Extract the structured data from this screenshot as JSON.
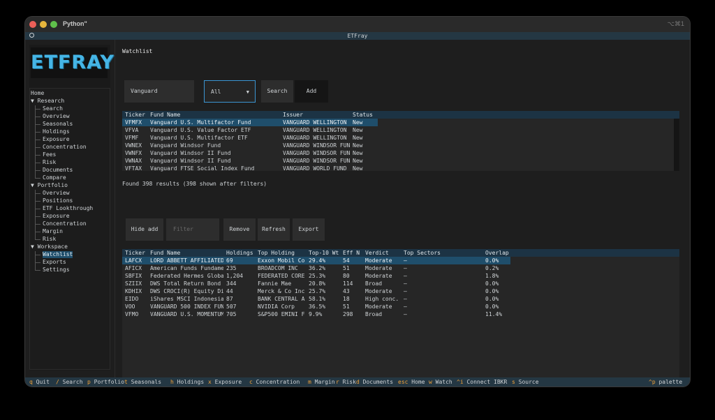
{
  "window": {
    "title": "Python\"",
    "shortcut": "⌥⌘1",
    "app_title": "ETFray"
  },
  "logo_text": "ETFRAY",
  "sidebar": {
    "items": [
      {
        "label": "Home",
        "type": "top"
      },
      {
        "label": "▼ Research",
        "type": "group"
      },
      {
        "label": "Search",
        "type": "child"
      },
      {
        "label": "Overview",
        "type": "child"
      },
      {
        "label": "Seasonals",
        "type": "child"
      },
      {
        "label": "Holdings",
        "type": "child"
      },
      {
        "label": "Exposure",
        "type": "child"
      },
      {
        "label": "Concentration",
        "type": "child"
      },
      {
        "label": "Fees",
        "type": "child"
      },
      {
        "label": "Risk",
        "type": "child"
      },
      {
        "label": "Documents",
        "type": "child"
      },
      {
        "label": "Compare",
        "type": "child"
      },
      {
        "label": "▼ Portfolio",
        "type": "group"
      },
      {
        "label": "Overview",
        "type": "child"
      },
      {
        "label": "Positions",
        "type": "child"
      },
      {
        "label": "ETF Lookthrough",
        "type": "child"
      },
      {
        "label": "Exposure",
        "type": "child"
      },
      {
        "label": "Concentration",
        "type": "child"
      },
      {
        "label": "Margin",
        "type": "child"
      },
      {
        "label": "Risk",
        "type": "child"
      },
      {
        "label": "▼ Workspace",
        "type": "group"
      },
      {
        "label": "Watchlist",
        "type": "child",
        "selected": true
      },
      {
        "label": "Exports",
        "type": "child"
      },
      {
        "label": "Settings",
        "type": "child"
      }
    ]
  },
  "main": {
    "heading": "Watchlist",
    "search_value": "Vanguard",
    "filter_select": "All",
    "search_label": "Search",
    "add_label": "Add",
    "results_columns": [
      "Ticker",
      "Fund Name",
      "Issuer",
      "Status"
    ],
    "results_rows": [
      [
        "VFMFX",
        "Vanguard U.S. Multifactor Fund",
        "VANGUARD WELLINGTON",
        "New"
      ],
      [
        "VFVA",
        "Vanguard U.S. Value Factor ETF",
        "VANGUARD WELLINGTON",
        "New"
      ],
      [
        "VFMF",
        "Vanguard U.S. Multifactor ETF",
        "VANGUARD WELLINGTON",
        "New"
      ],
      [
        "VWNEX",
        "Vanguard Windsor Fund",
        "VANGUARD WINDSOR FUN",
        "New"
      ],
      [
        "VWNFX",
        "Vanguard Windsor II Fund",
        "VANGUARD WINDSOR FUN",
        "New"
      ],
      [
        "VWNAX",
        "Vanguard Windsor II Fund",
        "VANGUARD WINDSOR FUN",
        "New"
      ],
      [
        "VFTAX",
        "Vanguard FTSE Social Index Fund",
        "VANGUARD WORLD FUND",
        "New"
      ]
    ],
    "results_summary": "Found 398 results (398 shown after filters)",
    "hide_add_label": "Hide add",
    "filter_placeholder": "Filter",
    "remove_label": "Remove",
    "refresh_label": "Refresh",
    "export_label": "Export",
    "watch_columns": [
      "Ticker",
      "Fund Name",
      "Holdings",
      "Top Holding",
      "Top-10 Wt",
      "Eff N",
      "Verdict",
      "Top Sectors",
      "Overlap"
    ],
    "watch_rows": [
      [
        "LAFCX",
        "LORD ABBETT AFFILIATED",
        "69",
        "Exxon Mobil Co",
        "29.4%",
        "54",
        "Moderate",
        "–",
        "0.0%"
      ],
      [
        "AFICX",
        "American Funds Fundame",
        "235",
        "BROADCOM INC",
        "36.2%",
        "51",
        "Moderate",
        "–",
        "0.2%"
      ],
      [
        "SBFIX",
        "Federated Hermes Globa",
        "1,204",
        "FEDERATED CORE",
        "25.3%",
        "80",
        "Moderate",
        "–",
        "1.8%"
      ],
      [
        "SZIIX",
        "DWS Total Return Bond",
        "344",
        "Fannie Mae",
        "20.8%",
        "114",
        "Broad",
        "–",
        "0.0%"
      ],
      [
        "KDHIX",
        "DWS CROCI(R) Equity Di",
        "44",
        "Merck & Co Inc",
        "25.7%",
        "43",
        "Moderate",
        "–",
        "0.0%"
      ],
      [
        "EIDO",
        "iShares MSCI Indonesia",
        "87",
        "BANK CENTRAL A",
        "58.1%",
        "18",
        "High conc.",
        "–",
        "0.0%"
      ],
      [
        "VOO",
        "VANGUARD 500 INDEX FUN",
        "507",
        "NVIDIA Corp",
        "36.5%",
        "51",
        "Moderate",
        "–",
        "0.0%"
      ],
      [
        "VFMO",
        "VANGUARD U.S. MOMENTUM",
        "705",
        "S&P500 EMINI F",
        "9.9%",
        "298",
        "Broad",
        "–",
        "11.4%"
      ]
    ]
  },
  "statusbar": {
    "items": [
      {
        "key": "q",
        "label": "Quit"
      },
      {
        "key": "/",
        "label": "Search"
      },
      {
        "key": "p",
        "label": "Portfolio"
      },
      {
        "key": "t",
        "label": "Seasonals"
      },
      {
        "key": "h",
        "label": "Holdings"
      },
      {
        "key": "x",
        "label": "Exposure"
      },
      {
        "key": "c",
        "label": "Concentration"
      },
      {
        "key": "m",
        "label": "Margin"
      },
      {
        "key": "r",
        "label": "Risk"
      },
      {
        "key": "d",
        "label": "Documents"
      },
      {
        "key": "esc",
        "label": "Home"
      },
      {
        "key": "w",
        "label": "Watch"
      },
      {
        "key": "^i",
        "label": "Connect IBKR"
      },
      {
        "key": "s",
        "label": "Source"
      }
    ],
    "palette": {
      "key": "^p",
      "label": "palette"
    }
  },
  "colors": {
    "accent": "#1f4e6b",
    "header_bar": "#243743",
    "key": "#f0a23a",
    "logo": "#45b5e6"
  }
}
